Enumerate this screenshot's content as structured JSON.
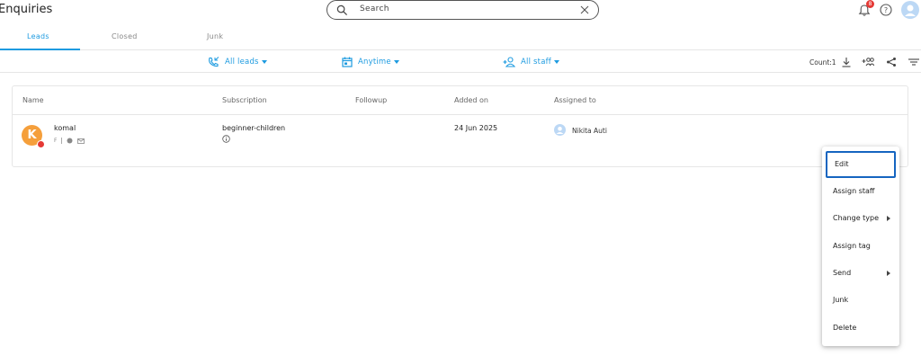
{
  "header": {
    "title": "Enquiries",
    "search_placeholder": "Search",
    "notification_count": "8"
  },
  "tabs": [
    {
      "label": "Leads",
      "active": true
    },
    {
      "label": "Closed",
      "active": false
    },
    {
      "label": "Junk",
      "active": false
    }
  ],
  "filters": {
    "leads": "All leads",
    "time": "Anytime",
    "staff": "All staff",
    "count": "Count:1"
  },
  "table": {
    "columns": [
      "Name",
      "Subscription",
      "Followup",
      "Added on",
      "Assigned to"
    ],
    "rows": [
      {
        "avatar_letter": "K",
        "name": "komal",
        "gender": "F",
        "subscription": "beginner-children",
        "followup": "",
        "added_on": "24 Jun 2025",
        "assigned_to": "Nikita Auti"
      }
    ]
  },
  "context_menu": {
    "items": [
      {
        "label": "Edit",
        "has_submenu": false,
        "focused": true
      },
      {
        "label": "Assign staff",
        "has_submenu": false
      },
      {
        "label": "Change type",
        "has_submenu": true
      },
      {
        "label": "Assign tag",
        "has_submenu": false
      },
      {
        "label": "Send",
        "has_submenu": true
      },
      {
        "label": "Junk",
        "has_submenu": false
      },
      {
        "label": "Delete",
        "has_submenu": false
      }
    ]
  },
  "colors": {
    "accent": "#1e9be0",
    "avatar": "#f59f3b",
    "badge": "#e53935",
    "focus": "#1565c0"
  }
}
